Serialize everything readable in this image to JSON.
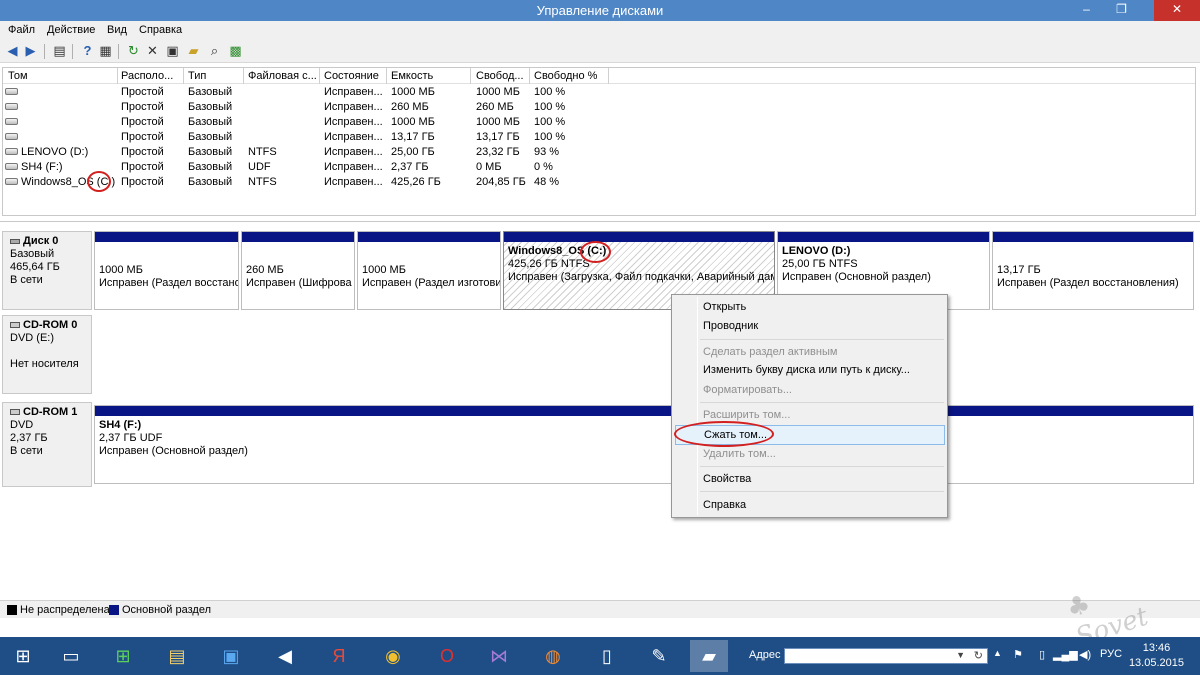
{
  "window": {
    "title": "Управление дисками",
    "minimize": "–",
    "maximize": "❐",
    "close": "✕"
  },
  "menu": [
    "Файл",
    "Действие",
    "Вид",
    "Справка"
  ],
  "toolbar_icons": [
    "back-icon",
    "forward-icon",
    "properties-pane-icon",
    "help-icon",
    "view-icon",
    "refresh-icon",
    "delete-icon",
    "properties-icon",
    "open-icon",
    "search-icon",
    "settings-icon"
  ],
  "volume_list": {
    "columns": [
      "Том",
      "Располо...",
      "Тип",
      "Файловая с...",
      "Состояние",
      "Емкость",
      "Свобод...",
      "Свободно %"
    ],
    "rows": [
      [
        "",
        "Простой",
        "Базовый",
        "",
        "Исправен...",
        "1000 МБ",
        "1000 МБ",
        "100 %"
      ],
      [
        "",
        "Простой",
        "Базовый",
        "",
        "Исправен...",
        "260 МБ",
        "260 МБ",
        "100 %"
      ],
      [
        "",
        "Простой",
        "Базовый",
        "",
        "Исправен...",
        "1000 МБ",
        "1000 МБ",
        "100 %"
      ],
      [
        "",
        "Простой",
        "Базовый",
        "",
        "Исправен...",
        "13,17 ГБ",
        "13,17 ГБ",
        "100 %"
      ],
      [
        "LENOVO (D:)",
        "Простой",
        "Базовый",
        "NTFS",
        "Исправен...",
        "25,00 ГБ",
        "23,32 ГБ",
        "93 %"
      ],
      [
        "SH4 (F:)",
        "Простой",
        "Базовый",
        "UDF",
        "Исправен...",
        "2,37 ГБ",
        "0 МБ",
        "0 %"
      ],
      [
        "Windows8_OS (C:)",
        "Простой",
        "Базовый",
        "NTFS",
        "Исправен...",
        "425,26 ГБ",
        "204,85 ГБ",
        "48 %"
      ]
    ]
  },
  "disks": [
    {
      "name": "Диск 0",
      "type": "Базовый",
      "size": "465,64 ГБ",
      "status": "В сети",
      "partitions": [
        {
          "title": "",
          "size": "1000 МБ",
          "status": "Исправен (Раздел восстано"
        },
        {
          "title": "",
          "size": "260 МБ",
          "status": "Исправен (Шифрова"
        },
        {
          "title": "",
          "size": "1000 МБ",
          "status": "Исправен (Раздел изготови"
        },
        {
          "title": "Windows8_OS  (C:)",
          "size": "425,26 ГБ NTFS",
          "status": "Исправен (Загрузка, Файл подкачки, Аварийный дамп"
        },
        {
          "title": "LENOVO  (D:)",
          "size": "25,00 ГБ NTFS",
          "status": "Исправен (Основной раздел)"
        },
        {
          "title": "",
          "size": "13,17 ГБ",
          "status": "Исправен (Раздел восстановления)"
        }
      ]
    },
    {
      "name": "CD-ROM 0",
      "type": "DVD (E:)",
      "size": "",
      "status": "Нет носителя",
      "partitions": []
    },
    {
      "name": "CD-ROM 1",
      "type": "DVD",
      "size": "2,37 ГБ",
      "status": "В сети",
      "partitions": [
        {
          "title": "SH4  (F:)",
          "size": "2,37 ГБ UDF",
          "status": "Исправен (Основной раздел)"
        }
      ]
    }
  ],
  "context_menu": [
    {
      "label": "Открыть",
      "enabled": true
    },
    {
      "label": "Проводник",
      "enabled": true
    },
    {
      "label": "Сделать раздел активным",
      "enabled": false
    },
    {
      "label": "Изменить букву диска или путь к диску...",
      "enabled": true
    },
    {
      "label": "Форматировать...",
      "enabled": false
    },
    {
      "label": "Расширить том...",
      "enabled": false
    },
    {
      "label": "Сжать том...",
      "enabled": true,
      "highlighted": true
    },
    {
      "label": "Удалить том...",
      "enabled": false
    },
    {
      "label": "Свойства",
      "enabled": true
    },
    {
      "label": "Справка",
      "enabled": true
    }
  ],
  "legend": [
    {
      "label": "Не распределена",
      "color": "#000000"
    },
    {
      "label": "Основной раздел",
      "color": "#0a1585"
    }
  ],
  "taskbar": {
    "address_label": "Адрес",
    "address_value": "",
    "language": "РУС",
    "time": "13:46",
    "date": "13.05.2015"
  },
  "watermark": "club Sovet",
  "colors": {
    "titlebar": "#4f86c6",
    "partition_bar": "#0a1585",
    "taskbar": "#1f4e86",
    "annotation_circle": "#d21f1f"
  }
}
